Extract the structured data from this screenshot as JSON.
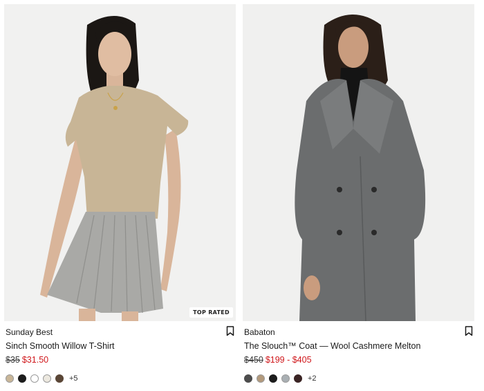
{
  "products": [
    {
      "badge": "TOP RATED",
      "brand": "Sunday Best",
      "name": "Sinch Smooth Willow T-Shirt",
      "price_original": "$35",
      "price_sale": "$31.50",
      "swatches": [
        "#c9b698",
        "#1c1c1c",
        "#ffffff",
        "#ece8df",
        "#5a4636"
      ],
      "more_colors": "+5"
    },
    {
      "brand": "Babaton",
      "name": "The Slouch™ Coat — Wool Cashmere Melton",
      "price_original": "$450",
      "price_sale": "$199 - $405",
      "swatches": [
        "#4d4d4d",
        "#b39a7c",
        "#1c1c1c",
        "#a9afb3",
        "#3b2424"
      ],
      "more_colors": "+2"
    }
  ],
  "colors": {
    "sale": "#d0171b",
    "text": "#1a1a1a"
  },
  "icons": {
    "bookmark": "bookmark-icon"
  }
}
